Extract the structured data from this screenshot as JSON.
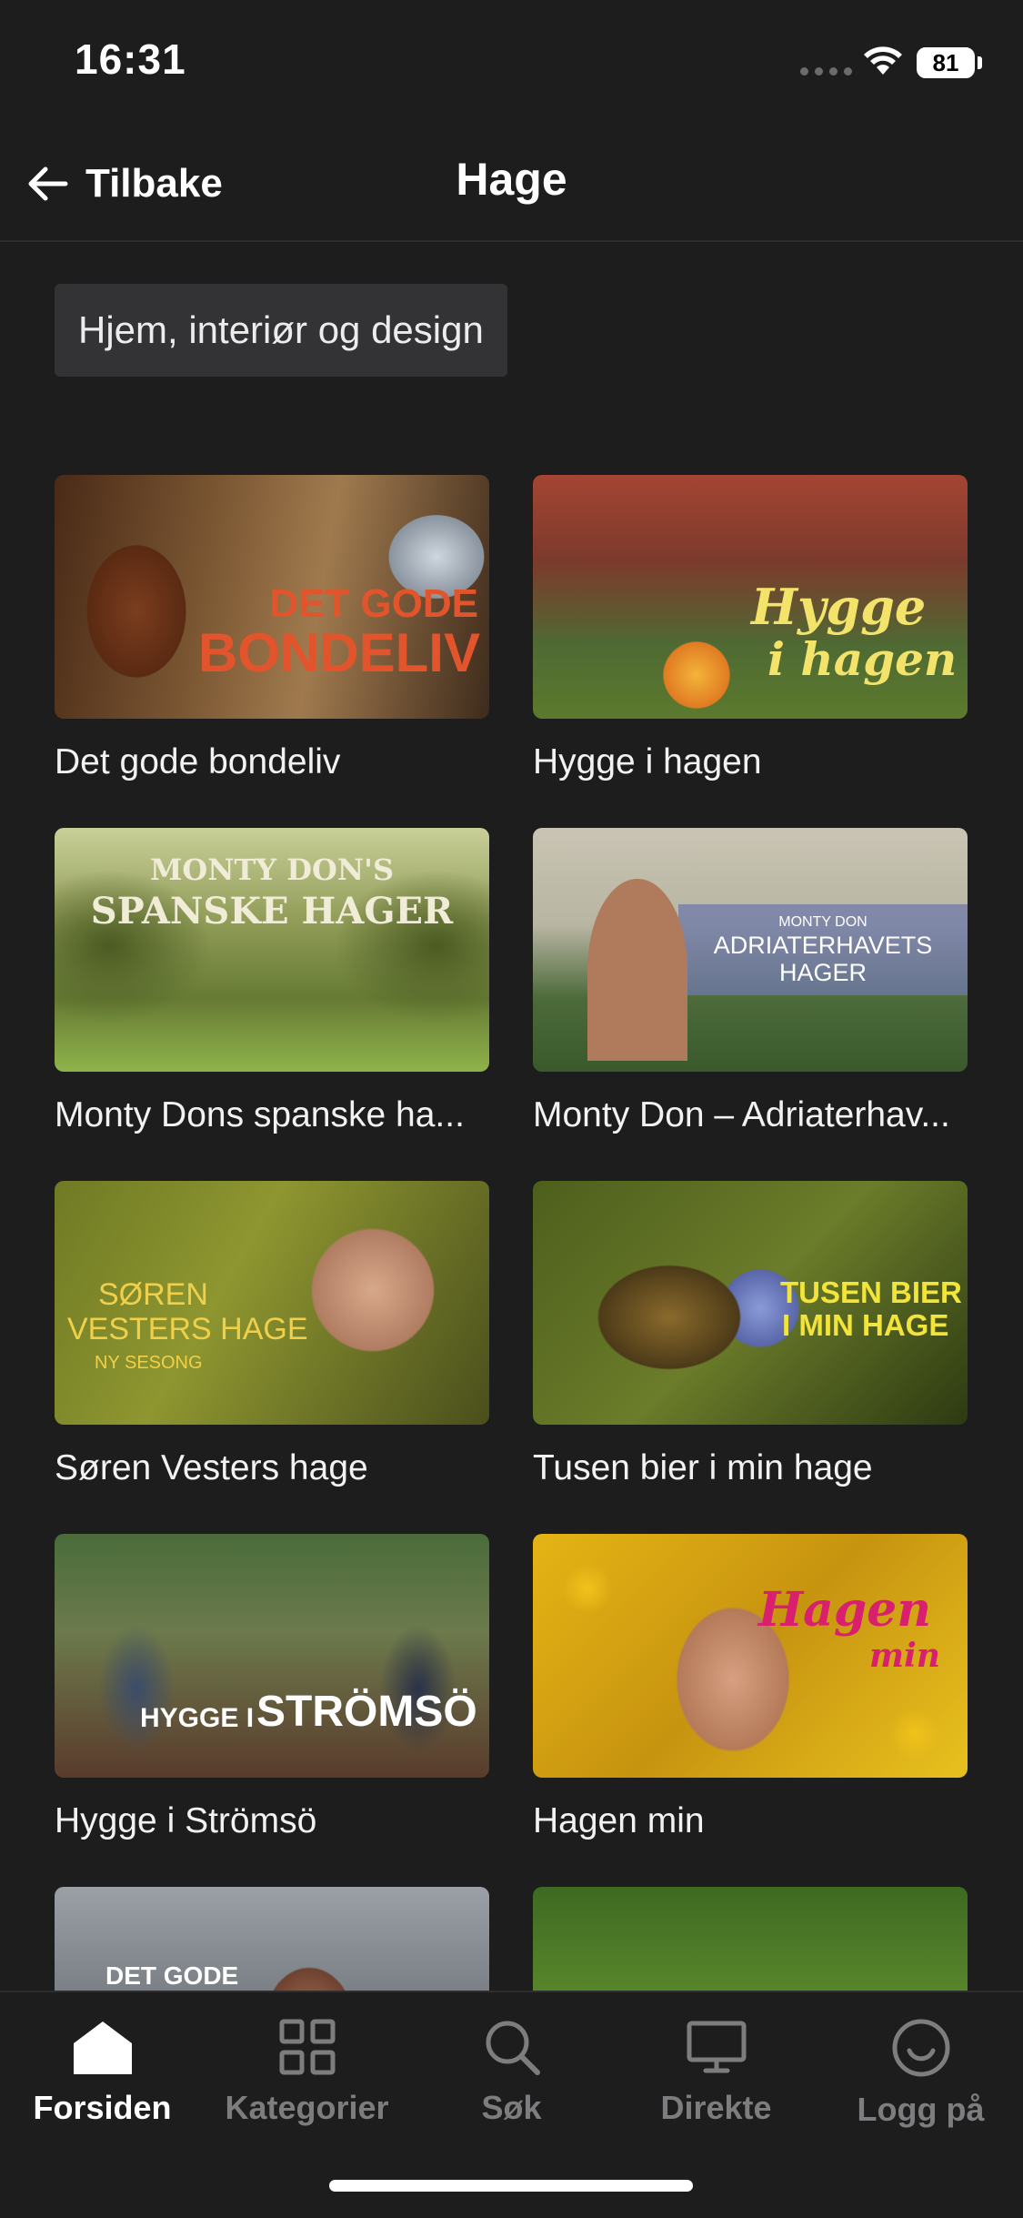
{
  "status_bar": {
    "time": "16:31",
    "battery": "81"
  },
  "header": {
    "back_label": "Tilbake",
    "title": "Hage"
  },
  "category_chip": {
    "label": "Hjem, interiør og design"
  },
  "programs": [
    {
      "title": "Det gode bondeliv",
      "thumb_text_1": "DET GODE",
      "thumb_text_2": "BONDELIV"
    },
    {
      "title": "Hygge i hagen",
      "thumb_text_1": "Hygge",
      "thumb_text_2": "i hagen"
    },
    {
      "title": "Monty Dons spanske ha...",
      "thumb_text_1": "MONTY DON'S",
      "thumb_text_2": "SPANSKE HAGER"
    },
    {
      "title": "Monty Don – Adriaterhav...",
      "thumb_text_1": "MONTY DON",
      "thumb_text_2": "ADRIATERHAVETS",
      "thumb_text_3": "HAGER"
    },
    {
      "title": "Søren Vesters hage",
      "thumb_text_1": "SØREN",
      "thumb_text_2": "VESTERS HAGE",
      "thumb_text_3": "NY SESONG"
    },
    {
      "title": "Tusen bier i min hage",
      "thumb_text_1": "TUSEN BIER",
      "thumb_text_2": "I MIN HAGE"
    },
    {
      "title": "Hygge i Strömsö",
      "thumb_text_1": "HYGGE I",
      "thumb_text_2": "STRÖMSÖ"
    },
    {
      "title": "Hagen min",
      "thumb_text_1": "Hagen",
      "thumb_text_2": "min"
    },
    {
      "title": "",
      "thumb_text_1": "DET GODE"
    },
    {
      "title": ""
    }
  ],
  "tab_bar": {
    "tabs": [
      {
        "label": "Forsiden",
        "icon": "home-icon",
        "active": true
      },
      {
        "label": "Kategorier",
        "icon": "grid-icon",
        "active": false
      },
      {
        "label": "Søk",
        "icon": "search-icon",
        "active": false
      },
      {
        "label": "Direkte",
        "icon": "tv-icon",
        "active": false
      },
      {
        "label": "Logg på",
        "icon": "profile-icon",
        "active": false
      }
    ]
  },
  "colors": {
    "background": "#1d1d1e",
    "chip": "#333335",
    "inactive_tab": "#7d7d7f",
    "active_tab": "#ffffff"
  }
}
